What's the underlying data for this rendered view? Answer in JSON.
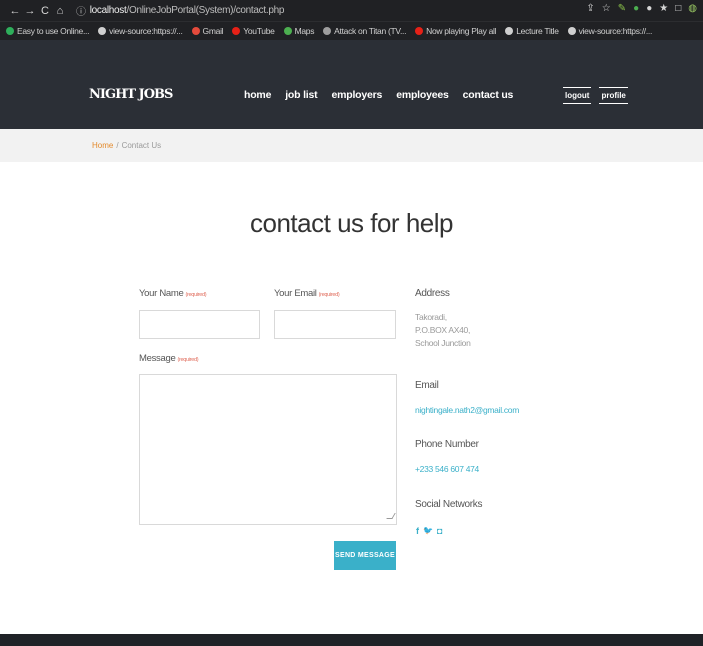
{
  "browser": {
    "nav_buttons": [
      "←",
      "→",
      "C",
      "⌂"
    ],
    "url_host": "localhost",
    "url_path": "/OnlineJobPortal(System)/contact.php",
    "info_icon": "ⓘ",
    "toolbar_icons": [
      "⇪",
      "☆",
      "✎",
      "●",
      "●",
      "★",
      "□",
      "◍"
    ],
    "bookmarks": [
      {
        "label": "Easy to use Online...",
        "icon": "s-badge-icon",
        "color": "#2eaf5b"
      },
      {
        "label": "view-source:https://...",
        "icon": "globe-icon",
        "color": "#cfcfcf"
      },
      {
        "label": "Gmail",
        "icon": "gmail-icon",
        "color": "#e54b3c"
      },
      {
        "label": "YouTube",
        "icon": "youtube-icon",
        "color": "#e62117"
      },
      {
        "label": "Maps",
        "icon": "maps-icon",
        "color": "#4caf50"
      },
      {
        "label": "Attack on Titan (TV...",
        "icon": "bookmark-icon",
        "color": "#9e9e9e"
      },
      {
        "label": "Now playing Play all",
        "icon": "youtube-icon",
        "color": "#e62117"
      },
      {
        "label": "Lecture Title",
        "icon": "globe-icon",
        "color": "#cfcfcf"
      },
      {
        "label": "view-source:https://...",
        "icon": "globe-icon",
        "color": "#cfcfcf"
      }
    ]
  },
  "header": {
    "logo": "NIGHT JOBS",
    "nav": [
      "home",
      "job list",
      "employers",
      "employees",
      "contact us"
    ],
    "user_nav": [
      "logout",
      "profile"
    ]
  },
  "breadcrumb": {
    "home": "Home",
    "separator": "/",
    "current": "Contact Us"
  },
  "main": {
    "title": "contact us for help",
    "form": {
      "name_label": "Your Name",
      "email_label": "Your Email",
      "message_label": "Message",
      "required_tag": "(required)",
      "name_value": "",
      "email_value": "",
      "message_value": "",
      "send_label": "SEND MESSAGE"
    },
    "info": {
      "address_head": "Address",
      "address_lines": [
        "Takoradi,",
        "P.O.BOX AX40,",
        "School Junction"
      ],
      "email_head": "Email",
      "email_value": "nightingale.nath2@gmail.com",
      "phone_head": "Phone Number",
      "phone_value": "+233 546 607 474",
      "social_head": "Social Networks",
      "social_icons": [
        "f",
        "🐦",
        "◘"
      ]
    }
  },
  "colors": {
    "accent": "#3ab0c9",
    "header_bg": "#2b2f36",
    "breadcrumb_home": "#e38a2c",
    "required": "#e06b5b"
  }
}
